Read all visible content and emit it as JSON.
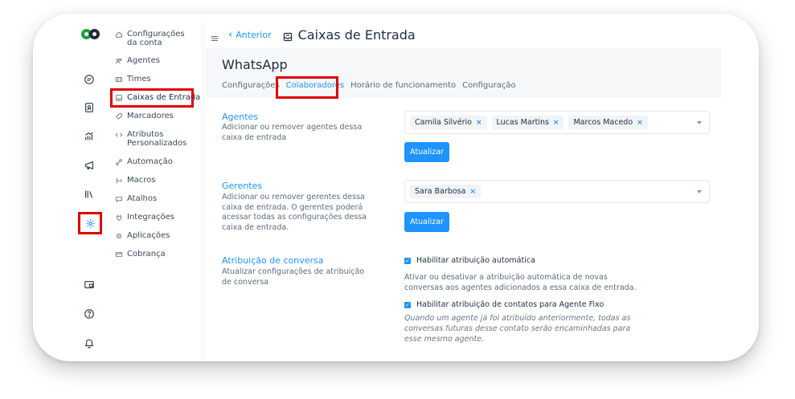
{
  "header": {
    "back_label": "Anterior",
    "title": "Caixas de Entrada"
  },
  "sidebar": {
    "items": [
      {
        "label": "Configurações da conta",
        "icon": "home-icon"
      },
      {
        "label": "Agentes",
        "icon": "users-icon"
      },
      {
        "label": "Times",
        "icon": "team-icon"
      },
      {
        "label": "Caixas de Entrada",
        "icon": "inbox-icon",
        "active": true
      },
      {
        "label": "Marcadores",
        "icon": "tag-icon"
      },
      {
        "label": "Atributos Personalizados",
        "icon": "code-icon"
      },
      {
        "label": "Automação",
        "icon": "automation-icon"
      },
      {
        "label": "Macros",
        "icon": "macro-icon"
      },
      {
        "label": "Atalhos",
        "icon": "chat-shortcut-icon"
      },
      {
        "label": "Integrações",
        "icon": "plug-icon"
      },
      {
        "label": "Aplicações",
        "icon": "apps-icon"
      },
      {
        "label": "Cobrança",
        "icon": "billing-icon"
      }
    ]
  },
  "inbox": {
    "name": "WhatsApp",
    "tabs": [
      "Configurações",
      "Colaboradores",
      "Horário de funcionamento",
      "Configuração"
    ],
    "active_tab": "Colaboradores"
  },
  "agents": {
    "title": "Agentes",
    "description": "Adicionar ou remover agentes dessa caixa de entrada",
    "selected": [
      "Camila Silvério",
      "Lucas Martins",
      "Marcos Macedo"
    ],
    "button": "Atualizar"
  },
  "managers": {
    "title": "Gerentes",
    "description": "Adicionar ou remover gerentes dessa caixa de entrada. O gerentes poderá acessar todas as configurações dessa caixa de entrada.",
    "selected": [
      "Sara Barbosa"
    ],
    "button": "Atualizar"
  },
  "assignment": {
    "title": "Atribuição de conversa",
    "description": "Atualizar configurações de atribuição de conversa",
    "auto_label": "Habilitar atribuição automática",
    "auto_checked": true,
    "auto_help": "Ativar ou desativar a atribuição automática de novas conversas aos agentes adicionados a essa caixa de entrada.",
    "fixed_label": "Habilitar atribuição de contatos para Agente Fixo",
    "fixed_checked": true,
    "fixed_help": "Quando um agente já foi atribuído anteriormente, todas as conversas futuras desse contato serão encaminhadas para esse mesmo agente."
  },
  "colors": {
    "accent": "#1f93ff",
    "highlight_box": "#e00000",
    "logo_green": "#1f9e3c"
  }
}
